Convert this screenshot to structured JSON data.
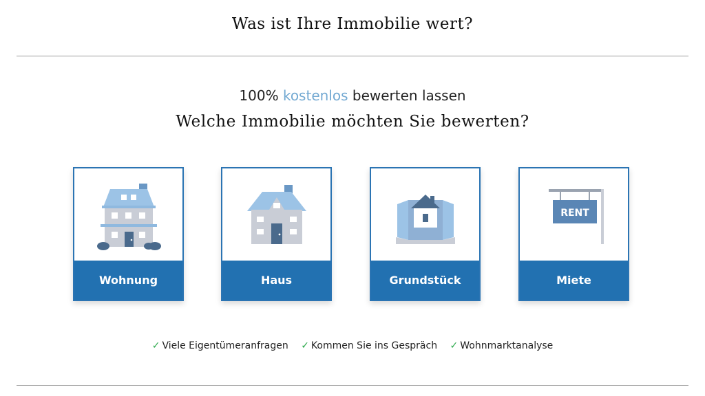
{
  "header": {
    "title": "Was ist Ihre Immobilie wert?"
  },
  "intro": {
    "prefix": "100%",
    "highlight": "kostenlos",
    "suffix": "bewerten lassen",
    "question": "Welche Immobilie möchten Sie bewerten?"
  },
  "cards": [
    {
      "label": "Wohnung",
      "icon": "apartment-building-icon"
    },
    {
      "label": "Haus",
      "icon": "house-icon"
    },
    {
      "label": "Grundstück",
      "icon": "land-plot-icon"
    },
    {
      "label": "Miete",
      "icon": "rent-sign-icon",
      "sign_text": "RENT"
    }
  ],
  "features": [
    {
      "check": "✓",
      "text": "Viele Eigentümeranfragen"
    },
    {
      "check": "✓",
      "text": "Kommen Sie ins Gespräch"
    },
    {
      "check": "✓",
      "text": "Wohnmarktanalyse"
    }
  ],
  "colors": {
    "accent": "#2271b1",
    "highlight": "#73a9d2",
    "check": "#2aa84a"
  }
}
